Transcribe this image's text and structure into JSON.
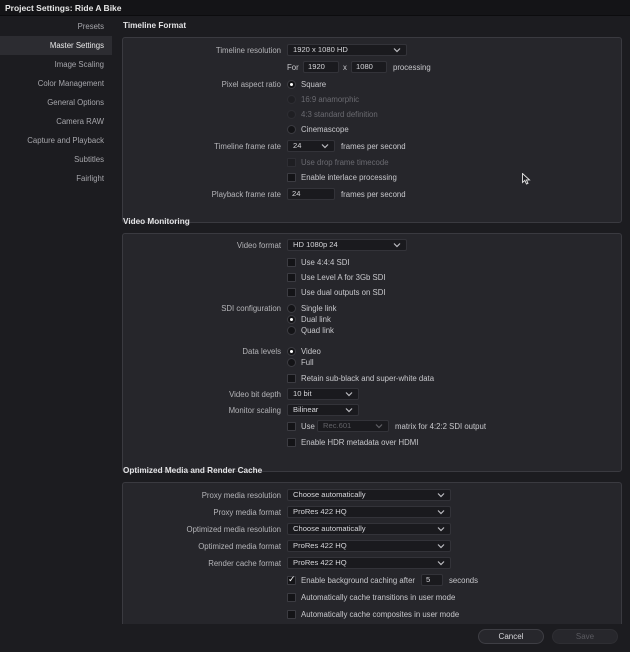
{
  "window": {
    "title": "Project Settings:  Ride A Bike"
  },
  "sidebar": {
    "items": [
      {
        "label": "Presets"
      },
      {
        "label": "Master Settings",
        "active": true
      },
      {
        "label": "Image Scaling"
      },
      {
        "label": "Color Management"
      },
      {
        "label": "General Options"
      },
      {
        "label": "Camera RAW"
      },
      {
        "label": "Capture and Playback"
      },
      {
        "label": "Subtitles"
      },
      {
        "label": "Fairlight"
      }
    ]
  },
  "timeline_format": {
    "title": "Timeline Format",
    "resolution": {
      "label": "Timeline resolution",
      "value": "1920 x 1080 HD"
    },
    "for_label": "For",
    "width": "1920",
    "x_label": "x",
    "height": "1080",
    "processing_label": "processing",
    "pixel_aspect": {
      "label": "Pixel aspect ratio",
      "options": [
        "Square",
        "16:9 anamorphic",
        "4:3 standard definition",
        "Cinemascope"
      ],
      "selected": "Square"
    },
    "frame_rate": {
      "label": "Timeline frame rate",
      "value": "24",
      "unit": "frames per second"
    },
    "drop_frame": {
      "label": "Use drop frame timecode",
      "checked": false,
      "disabled": true
    },
    "interlace": {
      "label": "Enable interlace processing",
      "checked": false
    },
    "playback_rate": {
      "label": "Playback frame rate",
      "value": "24",
      "unit": "frames per second"
    }
  },
  "video_monitoring": {
    "title": "Video Monitoring",
    "format": {
      "label": "Video format",
      "value": "HD 1080p 24"
    },
    "use_444": {
      "label": "Use 4:4:4 SDI",
      "checked": false
    },
    "level_a": {
      "label": "Use Level A for 3Gb SDI",
      "checked": false
    },
    "dual_outputs": {
      "label": "Use dual outputs on SDI",
      "checked": false
    },
    "sdi_config": {
      "label": "SDI configuration",
      "options": [
        "Single link",
        "Dual link",
        "Quad link"
      ],
      "selected": "Dual link"
    },
    "data_levels": {
      "label": "Data levels",
      "options": [
        "Video",
        "Full"
      ],
      "selected": "Video"
    },
    "retain": {
      "label": "Retain sub-black and super-white data",
      "checked": false
    },
    "bit_depth": {
      "label": "Video bit depth",
      "value": "10 bit"
    },
    "monitor_scaling": {
      "label": "Monitor scaling",
      "value": "Bilinear"
    },
    "use_matrix": {
      "label": "Use",
      "value": "Rec.601",
      "suffix": "matrix for 4:2:2 SDI output",
      "checked": false
    },
    "hdr_metadata": {
      "label": "Enable HDR metadata over HDMI",
      "checked": false
    }
  },
  "optimized_media": {
    "title": "Optimized Media and Render Cache",
    "proxy_resolution": {
      "label": "Proxy media resolution",
      "value": "Choose automatically"
    },
    "proxy_format": {
      "label": "Proxy media format",
      "value": "ProRes 422 HQ"
    },
    "optimized_resolution": {
      "label": "Optimized media resolution",
      "value": "Choose automatically"
    },
    "optimized_format": {
      "label": "Optimized media format",
      "value": "ProRes 422 HQ"
    },
    "render_format": {
      "label": "Render cache format",
      "value": "ProRes 422 HQ"
    },
    "bg_caching": {
      "label": "Enable background caching after",
      "value": "5",
      "unit": "seconds",
      "checked": true
    },
    "cache_transitions": {
      "label": "Automatically cache transitions in user mode",
      "checked": false
    },
    "cache_composites": {
      "label": "Automatically cache composites in user mode",
      "checked": false
    }
  },
  "footer": {
    "cancel_label": "Cancel",
    "save_label": "Save"
  },
  "icons": {
    "chevron": "chevron-down-icon",
    "cursor": "mouse-cursor-icon"
  },
  "colors": {
    "background": "#1c1c20",
    "panel": "#26262b",
    "text": "#c8c8cc"
  }
}
